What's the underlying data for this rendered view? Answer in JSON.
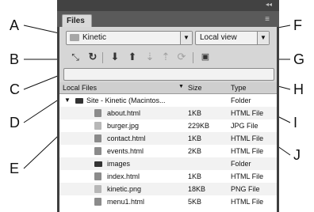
{
  "panel": {
    "tab_label": "Files",
    "site_select": "Kinetic",
    "view_select": "Local view"
  },
  "toolbar": {
    "icons": [
      "connect-icon",
      "refresh-icon",
      "get-files-icon",
      "put-files-icon",
      "check-out-icon",
      "check-in-icon",
      "sync-icon",
      "expand-icon"
    ]
  },
  "table": {
    "headers": [
      "Local Files",
      "Size",
      "Type"
    ],
    "rows": [
      {
        "name": "Site - Kinetic (Macintos...",
        "size": "",
        "type": "Folder",
        "kind": "site"
      },
      {
        "name": "about.html",
        "size": "1KB",
        "type": "HTML File",
        "kind": "html"
      },
      {
        "name": "burger.jpg",
        "size": "229KB",
        "type": "JPG File",
        "kind": "img"
      },
      {
        "name": "contact.html",
        "size": "1KB",
        "type": "HTML File",
        "kind": "html"
      },
      {
        "name": "events.html",
        "size": "2KB",
        "type": "HTML File",
        "kind": "html"
      },
      {
        "name": "images",
        "size": "",
        "type": "Folder",
        "kind": "folder"
      },
      {
        "name": "index.html",
        "size": "1KB",
        "type": "HTML File",
        "kind": "html"
      },
      {
        "name": "kinetic.png",
        "size": "18KB",
        "type": "PNG File",
        "kind": "img"
      },
      {
        "name": "menu1.html",
        "size": "5KB",
        "type": "HTML File",
        "kind": "html"
      }
    ]
  },
  "callouts": {
    "left": [
      "A",
      "B",
      "C",
      "D",
      "E"
    ],
    "right": [
      "F",
      "G",
      "H",
      "I",
      "J"
    ]
  }
}
